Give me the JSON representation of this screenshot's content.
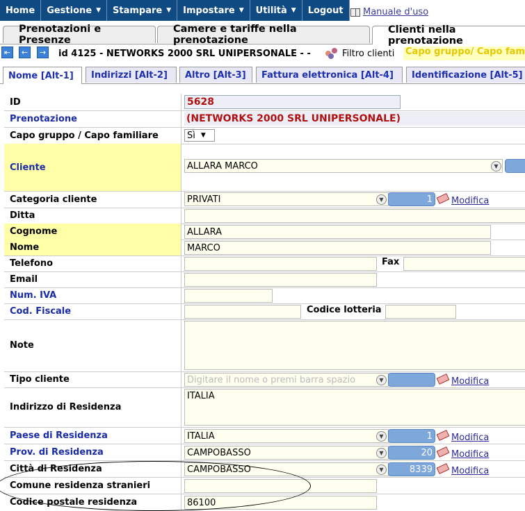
{
  "menu": [
    {
      "label": "Home",
      "arrow": ""
    },
    {
      "label": "Gestione",
      "arrow": "▼"
    },
    {
      "label": "Stampare",
      "arrow": "▼"
    },
    {
      "label": "Impostare",
      "arrow": "▼"
    },
    {
      "label": "Utilità",
      "arrow": "▼"
    },
    {
      "label": "Logout",
      "arrow": ""
    }
  ],
  "manual_label": "Manuale d'uso",
  "main_tabs": [
    "Prenotazioni e Presenze",
    "Camere e tariffe nella prenotazione",
    "Clienti nella prenotazione"
  ],
  "record_title": "id 4125 - NETWORKS 2000 SRL UNIPERSONALE - -",
  "filter_label": "Filtro clienti",
  "filter_value": "Capo gruppo/ Capo familiare",
  "sub_tabs": [
    "Nome [Alt-1]",
    "Indirizzi [Alt-2]",
    "Altro [Alt-3]",
    "Fattura elettronica [Alt-4]",
    "Identificazione [Alt-5]"
  ],
  "form": {
    "id_label": "ID",
    "id_value": "5628",
    "pren_label": "Prenotazione",
    "pren_value": "(NETWORKS 2000 SRL UNIPERSONALE)",
    "capo_label": "Capo gruppo / Capo familiare",
    "capo_value": "Sì",
    "cliente_label": "Cliente",
    "cliente_value": "ALLARA MARCO",
    "categoria_label": "Categoria cliente",
    "categoria_value": "PRIVATI",
    "categoria_num": "1",
    "ditta_label": "Ditta",
    "cognome_label": "Cognome",
    "cognome_value": "ALLARA",
    "nome_label": "Nome",
    "nome_value": "MARCO",
    "telefono_label": "Telefono",
    "fax_label": "Fax",
    "email_label": "Email",
    "iva_label": "Num. IVA",
    "cf_label": "Cod. Fiscale",
    "lotteria_label": "Codice lotteria",
    "note_label": "Note",
    "tipo_label": "Tipo cliente",
    "tipo_placeholder": "Digitare il nome o premi barra spazio",
    "indirizzo_label": "Indirizzo di Residenza",
    "indirizzo_value": "ITALIA",
    "paese_label": "Paese di Residenza",
    "paese_value": "ITALIA",
    "paese_num": "1",
    "prov_label": "Prov. di Residenza",
    "prov_value": "CAMPOBASSO",
    "prov_num": "20",
    "citta_label": "Città di Residenza",
    "citta_value": "CAMPOBASSO",
    "citta_num": "8339",
    "comune_label": "Comune residenza stranieri",
    "cap_label": "Codice postale residenza",
    "cap_value": "86100",
    "modifica": "Modifica"
  }
}
